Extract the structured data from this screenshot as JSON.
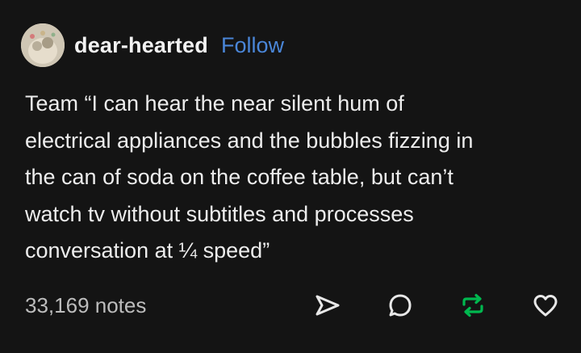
{
  "post": {
    "author": "dear-hearted",
    "follow_label": "Follow",
    "text": "Team “I can hear the near silent hum of\nelectrical appliances and the bubbles fizzing in\nthe can of soda on the coffee table, but can’t\nwatch tv without subtitles and processes\nconversation at ¼ speed”",
    "notes": "33,169 notes"
  },
  "icons": {
    "avatar": "avatar-image",
    "share": "share-icon",
    "reply": "reply-icon",
    "reblog": "reblog-icon",
    "like": "heart-icon"
  },
  "colors": {
    "background": "#141414",
    "text": "#ededed",
    "follow": "#4a86d8",
    "notes": "#bdbdbd",
    "reblog": "#00b84f"
  }
}
